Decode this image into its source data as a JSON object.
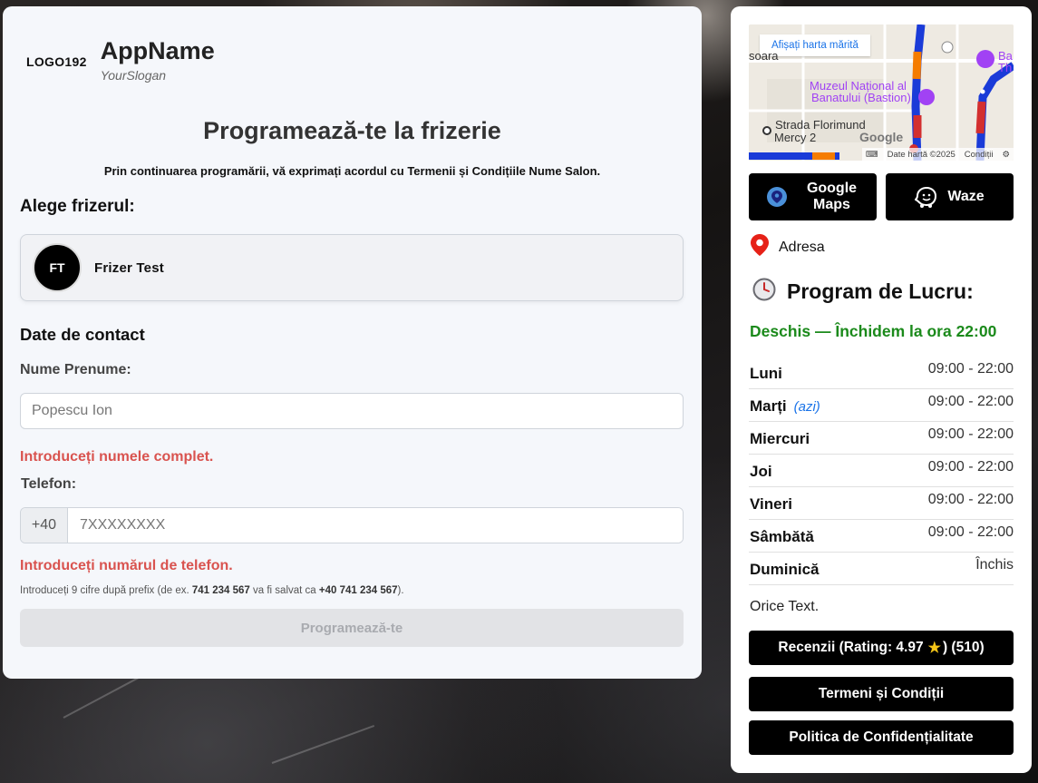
{
  "brand": {
    "logo": "LOGO192",
    "app_name": "AppName",
    "slogan": "YourSlogan"
  },
  "booking": {
    "title": "Programează-te la frizerie",
    "consent": "Prin continuarea programării, vă exprimați acordul cu Termenii și Condițiile Nume Salon.",
    "choose_barber_heading": "Alege frizerul:",
    "barber": {
      "initials": "FT",
      "name": "Frizer Test"
    },
    "contact_heading": "Date de contact",
    "name_label": "Nume Prenume:",
    "name_placeholder": "Popescu Ion",
    "name_error": "Introduceți numele complet.",
    "phone_label": "Telefon:",
    "phone_prefix": "+40",
    "phone_placeholder": "7XXXXXXXX",
    "phone_error": "Introduceți numărul de telefon.",
    "hint_pre": "Introduceți 9 cifre după prefix (de ex. ",
    "hint_example": "741 234 567",
    "hint_mid": " va fi salvat ca ",
    "hint_saved": "+40 741 234 567",
    "hint_post": ").",
    "submit_label": "Programează-te"
  },
  "map": {
    "enlarge_label": "Afișați harta mărită",
    "label_museum_1": "Muzeul Național al",
    "label_museum_2": "Banatului (Bastion)",
    "label_street_1": "Strada Florimund",
    "label_street_2": "Mercy 2",
    "label_partial_left": "soara",
    "label_partial_right_1": "Ba",
    "label_partial_right_2": "Th",
    "watermark": "Google",
    "data_label": "Date hartă ©2025",
    "terms_label": "Condiții"
  },
  "navigation": {
    "google_maps_label": "Google Maps",
    "waze_label": "Waze"
  },
  "address_label": "Adresa",
  "hours": {
    "title": "Program de Lucru:",
    "status": "Deschis — Închidem la ora 22:00",
    "today_label": "(azi)",
    "days": [
      {
        "day": "Luni",
        "time": "09:00 - 22:00"
      },
      {
        "day": "Marți",
        "time": "09:00 - 22:00"
      },
      {
        "day": "Miercuri",
        "time": "09:00 - 22:00"
      },
      {
        "day": "Joi",
        "time": "09:00 - 22:00"
      },
      {
        "day": "Vineri",
        "time": "09:00 - 22:00"
      },
      {
        "day": "Sâmbătă",
        "time": "09:00 - 22:00"
      },
      {
        "day": "Duminică",
        "time": "Închis"
      }
    ]
  },
  "other_text": "Orice Text.",
  "reviews": {
    "prefix": "Recenzii (Rating: 4.97",
    "suffix": ") (510)"
  },
  "terms_label": "Termeni și Condiții",
  "privacy_label": "Politica de Confidențialitate",
  "colors": {
    "accent_black": "#000000",
    "error_red": "#d9534f",
    "open_green": "#1b8a1b",
    "today_blue": "#1a73e8",
    "disabled_button": "#e2e3e6"
  }
}
